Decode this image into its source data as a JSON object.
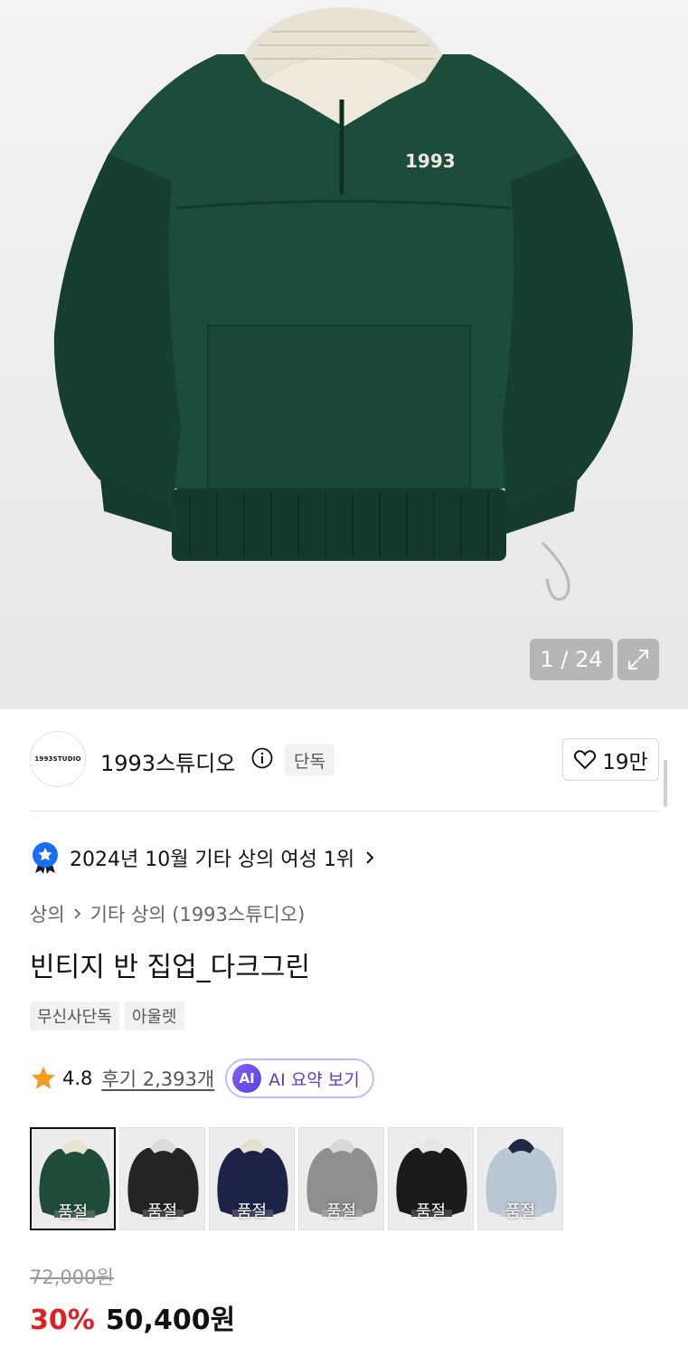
{
  "gallery": {
    "counter": "1 / 24",
    "logo_text": "1993"
  },
  "brand": {
    "logo_text": "1993STUDIO",
    "name": "1993스튜디오",
    "exclusive_tag": "단독",
    "likes": "19만"
  },
  "ranking": {
    "text": "2024년 10월 기타 상의 여성 1위"
  },
  "breadcrumb": {
    "level1": "상의",
    "level2": "기타 상의 (1993스튜디오)"
  },
  "product": {
    "title": "빈티지 반 집업_다크그린",
    "tags": [
      "무신사단독",
      "아울렛"
    ]
  },
  "rating": {
    "score": "4.8",
    "reviews": "후기 2,393개",
    "ai_badge": "AI",
    "ai_label": "AI 요약 보기"
  },
  "variants": [
    {
      "color": "#1f4d3a",
      "collar": "#e8e2d2",
      "label": "품절",
      "selected": true
    },
    {
      "color": "#242424",
      "collar": "#dcdcdc",
      "label": "품절",
      "selected": false
    },
    {
      "color": "#1c2347",
      "collar": "#e6e0d0",
      "label": "품절",
      "selected": false
    },
    {
      "color": "#8f8f8f",
      "collar": "#d8d8d8",
      "label": "품절",
      "selected": false
    },
    {
      "color": "#1b1b1b",
      "collar": "#e5e5e5",
      "label": "품절",
      "selected": false
    },
    {
      "color": "#b9c6d3",
      "collar": "#1e2a44",
      "label": "품절",
      "selected": false
    }
  ],
  "price": {
    "original": "72,000원",
    "discount": "30%",
    "final": "50,400원"
  },
  "colors": {
    "sweatshirt": "#1c4d3a",
    "discount": "#e02020",
    "verified_badge": "#1a6ef5"
  }
}
